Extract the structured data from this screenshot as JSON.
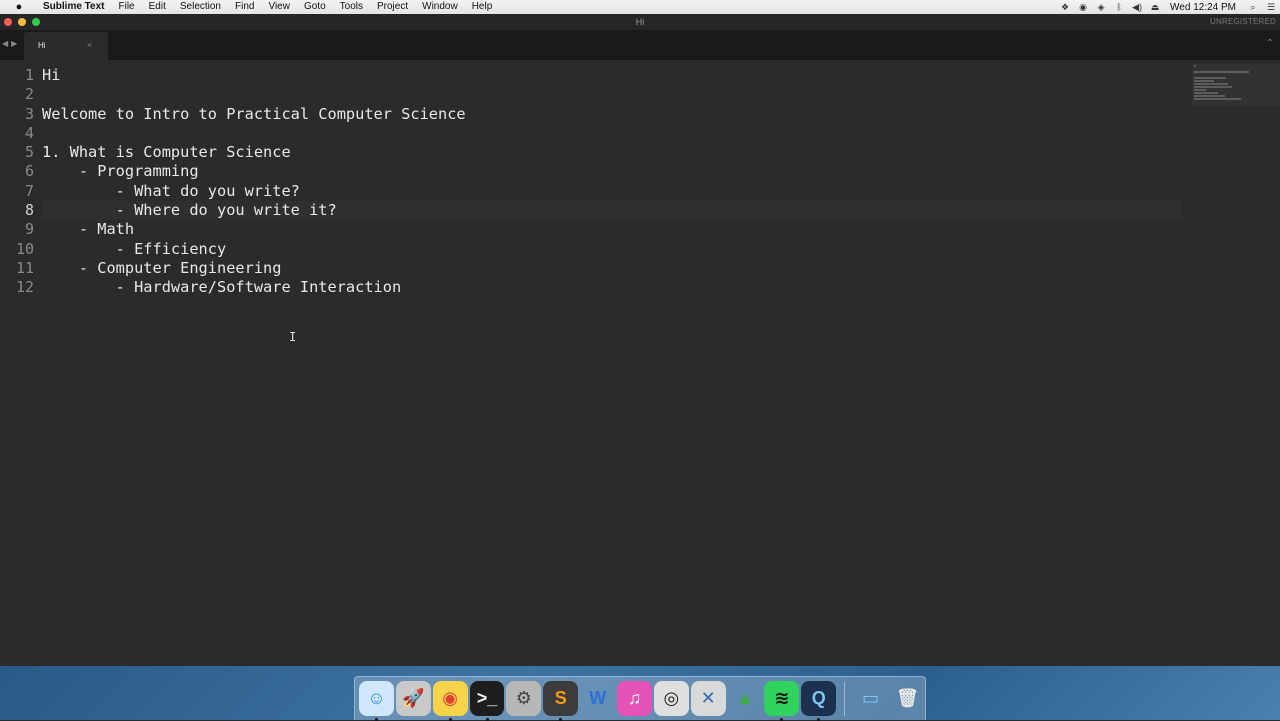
{
  "menubar": {
    "app_name": "Sublime Text",
    "items": [
      "File",
      "Edit",
      "Selection",
      "Find",
      "View",
      "Goto",
      "Tools",
      "Project",
      "Window",
      "Help"
    ],
    "clock": "Wed 12:24 PM"
  },
  "window": {
    "title": "Hi",
    "registration_label": "UNREGISTERED"
  },
  "tab": {
    "label": "Hi",
    "close_glyph": "×"
  },
  "editor": {
    "active_line": 8,
    "line_numbers": [
      "1",
      "2",
      "3",
      "4",
      "5",
      "6",
      "7",
      "8",
      "9",
      "10",
      "11",
      "12"
    ],
    "lines": [
      "Hi",
      "",
      "Welcome to Intro to Practical Computer Science",
      "",
      "1. What is Computer Science",
      "    - Programming",
      "        - What do you write?",
      "        - Where do you write it?",
      "    - Math",
      "        - Efficiency",
      "    - Computer Engineering",
      "        - Hardware/Software Interaction"
    ]
  },
  "dock": {
    "apps": [
      {
        "name": "finder-icon",
        "glyph": "☺",
        "color": "#2f8ee8",
        "bg": "#cfe6fb",
        "running": true
      },
      {
        "name": "launchpad-icon",
        "glyph": "🚀",
        "color": "#555",
        "bg": "#c9c9c9",
        "running": false
      },
      {
        "name": "chrome-icon",
        "glyph": "◉",
        "color": "#e34133",
        "bg": "#f5d44c",
        "running": true
      },
      {
        "name": "terminal-icon",
        "glyph": ">_",
        "color": "#eeeeee",
        "bg": "#1e1e1e",
        "running": true
      },
      {
        "name": "system-preferences-icon",
        "glyph": "⚙",
        "color": "#444",
        "bg": "#b7b7b7",
        "running": false
      },
      {
        "name": "sublime-text-icon",
        "glyph": "S",
        "color": "#ff9a16",
        "bg": "#3c3c3c",
        "running": true
      },
      {
        "name": "word-icon",
        "glyph": "W",
        "color": "#2b6fd6",
        "bg": "transparent",
        "running": false
      },
      {
        "name": "itunes-icon",
        "glyph": "♫",
        "color": "#ffffff",
        "bg": "#e553b6",
        "running": false
      },
      {
        "name": "disk-utility-icon",
        "glyph": "◎",
        "color": "#222",
        "bg": "#dfdfdf",
        "running": false
      },
      {
        "name": "xcode-icon",
        "glyph": "✕",
        "color": "#2b6fb8",
        "bg": "#d9d9d9",
        "running": false
      },
      {
        "name": "android-studio-icon",
        "glyph": "▲",
        "color": "#3ea945",
        "bg": "transparent",
        "running": false
      },
      {
        "name": "spotify-icon",
        "glyph": "≋",
        "color": "#111111",
        "bg": "#2fd35d",
        "running": true
      },
      {
        "name": "quicktime-icon",
        "glyph": "Q",
        "color": "#7cc4f2",
        "bg": "#1c3050",
        "running": true
      }
    ],
    "stacks": [
      {
        "name": "downloads-folder-icon",
        "glyph": "▭",
        "color": "#7ec6f5",
        "bg": "transparent"
      },
      {
        "name": "trash-icon",
        "glyph": "🗑",
        "color": "#e6e6e6",
        "bg": "transparent"
      }
    ]
  }
}
